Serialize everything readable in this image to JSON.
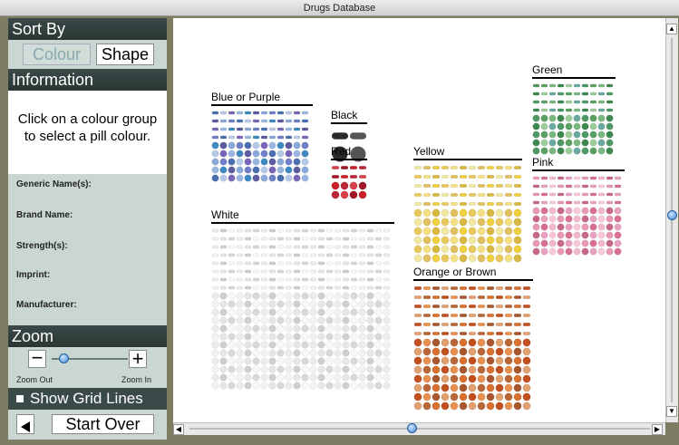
{
  "window": {
    "title": "Drugs Database"
  },
  "sidebar": {
    "sort_header": "Sort By",
    "colour_button": "Colour",
    "shape_button": "Shape",
    "info_header": "Information",
    "info_message_line1": "Click on a colour group",
    "info_message_line2": "to select a pill colour.",
    "fields": {
      "generic": "Generic Name(s):",
      "brand": "Brand Name:",
      "strength": "Strength(s):",
      "imprint": "Imprint:",
      "manufacturer": "Manufacturer:"
    },
    "zoom_header": "Zoom",
    "zoom_out_label": "Zoom Out",
    "zoom_in_label": "Zoom In",
    "zoom_level": 0.12,
    "grid_lines_label": "Show Grid Lines",
    "start_over_label": "Start Over"
  },
  "groups": [
    {
      "name": "Blue or Purple",
      "palette": [
        "#4a6fb0",
        "#6f7fc8",
        "#8aa8d8",
        "#5c5c9e",
        "#3e8ac0",
        "#9ab6e0",
        "#7a66b8",
        "#b6c8e8"
      ]
    },
    {
      "name": "Black",
      "palette": [
        "#111111",
        "#2a2a2a",
        "#555555"
      ]
    },
    {
      "name": "Red",
      "palette": [
        "#c8202a",
        "#a01828",
        "#d8404a",
        "#b82838"
      ]
    },
    {
      "name": "White",
      "palette": [
        "#f2f2f2",
        "#e6e6e6",
        "#d8d8d8",
        "#ececec",
        "#cfcfcf",
        "#f8f8f8"
      ]
    },
    {
      "name": "Yellow",
      "palette": [
        "#f0d040",
        "#e8c85a",
        "#f4e080",
        "#d8b840",
        "#f0e8a0",
        "#e0c060"
      ]
    },
    {
      "name": "Green",
      "palette": [
        "#5aa060",
        "#7ab880",
        "#3e8850",
        "#9ccc98",
        "#6aa8a0",
        "#4e9868"
      ]
    },
    {
      "name": "Pink",
      "palette": [
        "#e898b0",
        "#d87090",
        "#f0b8c8",
        "#c86888",
        "#e8a0c0",
        "#f8c8d8"
      ]
    },
    {
      "name": "Orange or Brown",
      "palette": [
        "#d87030",
        "#c05020",
        "#e89050",
        "#a85830",
        "#e0a070",
        "#b86838"
      ]
    }
  ],
  "scroll": {
    "vertical": 0.48,
    "horizontal": 0.48
  }
}
